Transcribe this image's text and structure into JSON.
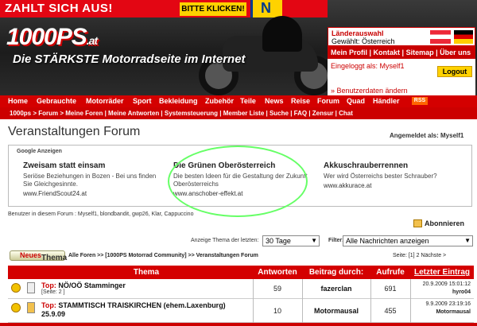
{
  "ad_banner": {
    "text": "ZAHLT SICH AUS!",
    "button": "BITTE KLICKEN!",
    "brand_letter": "N"
  },
  "logo": {
    "text": "1000PS",
    "suffix": ".at"
  },
  "slogan": "Die STÄRKSTE Motorradseite im Internet",
  "country": {
    "label": "Länderauswahl",
    "selected": "Gewählt: Österreich"
  },
  "user_links": [
    "Mein Profil",
    "Kontakt",
    "Sitemap",
    "Über uns"
  ],
  "login": {
    "status": "Eingeloggt als: Myself1",
    "logout": "Logout",
    "change": "» Benutzerdaten ändern"
  },
  "main_nav": [
    "Home",
    "Gebrauchte",
    "Motorräder",
    "Sport",
    "Bekleidung",
    "Zubehör",
    "Teile",
    "News",
    "Reise",
    "Forum",
    "Quad",
    "Händler"
  ],
  "rss": "RSS",
  "sub_nav": "1000ps > Forum > Meine Foren | Meine Antworten | Systemsteuerung | Member Liste | Suche | FAQ | Zensur | Chat",
  "page_title": "Veranstaltungen Forum",
  "signed_in": "Angemeldet als: Myself1",
  "google_ads": {
    "header": "Google Anzeigen",
    "items": [
      {
        "title": "Zweisam statt einsam",
        "desc": "Seriöse Beziehungen in Bozen - Bei uns finden Sie Gleichgesinnte.",
        "url": "www.FriendScout24.at"
      },
      {
        "title": "Die Grünen Oberösterreich",
        "desc": "Die besten Ideen für die Gestaltung der Zukunft Oberösterreichs",
        "url": "www.anschober-effekt.at"
      },
      {
        "title": "Akkuschrauberrennen",
        "desc": "Wer wird Österreichs bester Schrauber?",
        "url": "www.akkurace.at"
      }
    ]
  },
  "users_line": "Benutzer in diesem Forum : Myself1, blondbandit, gwp26, Klar, Cappuccino",
  "subscribe": "Abonnieren",
  "filter": {
    "label": "Anzeige Thema der letzten:",
    "value": "30 Tage",
    "filter_label": "Filter:",
    "filter_value": "Alle Nachrichten anzeigen"
  },
  "new_topic": {
    "new": "Neues",
    "thema": "Thema"
  },
  "breadcrumb": "Alle Foren >> [1000PS Motorrad Community] >> Veranstaltungen Forum",
  "pagination": "Seite: [1] 2  Nächste >",
  "table": {
    "headers": [
      "Thema",
      "Antworten",
      "Beitrag durch:",
      "Aufrufe",
      "Letzter Eintrag"
    ],
    "rows": [
      {
        "prefix": "Top:",
        "title": "NÖ/OÖ Stamminger",
        "sub": "[Seite: 2 ]",
        "replies": "59",
        "author": "fazerclan",
        "views": "691",
        "last_date": "20.9.2009 15:01:12",
        "last_user": "hyro04"
      },
      {
        "prefix": "Top:",
        "title": "STAMMTISCH TRAISKIRCHEN (ehem.Laxenburg) 25.9.09",
        "sub": "",
        "replies": "10",
        "author": "Motormausal",
        "views": "455",
        "last_date": "9.9.2009 23:19:16",
        "last_user": "Motormausal"
      }
    ]
  },
  "colors": {
    "brand_red": "#d40000",
    "accent_yellow": "#ffd200",
    "highlight_green": "#66ff66"
  }
}
